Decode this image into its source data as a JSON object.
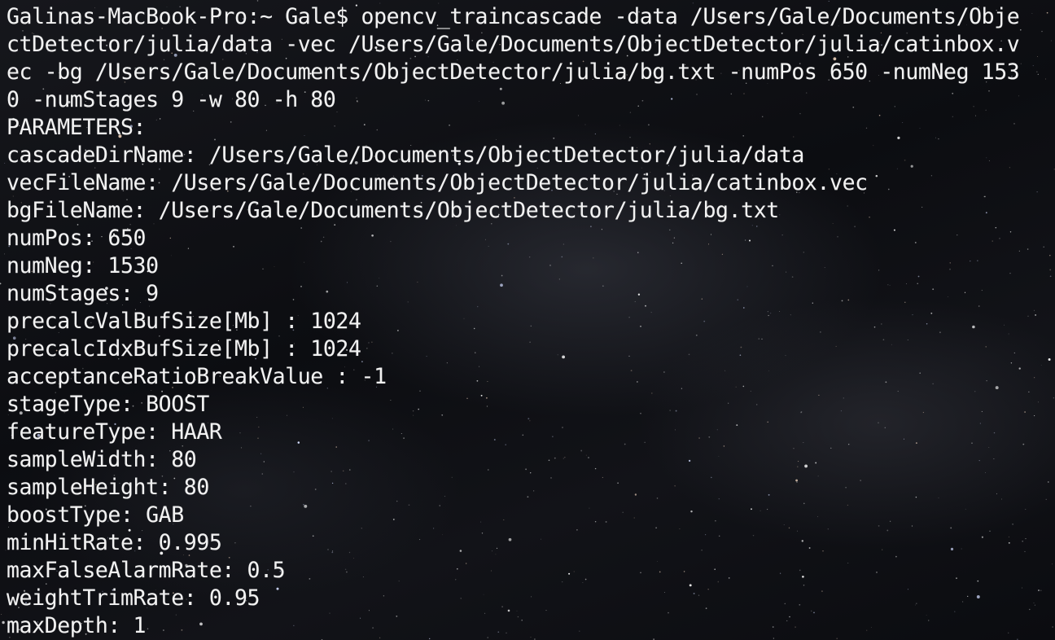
{
  "terminal": {
    "background": "#0a0b0f",
    "text_color": "#f2f2f2",
    "lines": [
      "Galinas-MacBook-Pro:~ Gale$ opencv_traincascade -data /Users/Gale/Documents/Obje",
      "ctDetector/julia/data -vec /Users/Gale/Documents/ObjectDetector/julia/catinbox.v",
      "ec -bg /Users/Gale/Documents/ObjectDetector/julia/bg.txt -numPos 650 -numNeg 153",
      "0 -numStages 9 -w 80 -h 80",
      "PARAMETERS:",
      "cascadeDirName: /Users/Gale/Documents/ObjectDetector/julia/data",
      "vecFileName: /Users/Gale/Documents/ObjectDetector/julia/catinbox.vec",
      "bgFileName: /Users/Gale/Documents/ObjectDetector/julia/bg.txt",
      "numPos: 650",
      "numNeg: 1530",
      "numStages: 9",
      "precalcValBufSize[Mb] : 1024",
      "precalcIdxBufSize[Mb] : 1024",
      "acceptanceRatioBreakValue : -1",
      "stageType: BOOST",
      "featureType: HAAR",
      "sampleWidth: 80",
      "sampleHeight: 80",
      "boostType: GAB",
      "minHitRate: 0.995",
      "maxFalseAlarmRate: 0.5",
      "weightTrimRate: 0.95",
      "maxDepth: 1"
    ]
  }
}
